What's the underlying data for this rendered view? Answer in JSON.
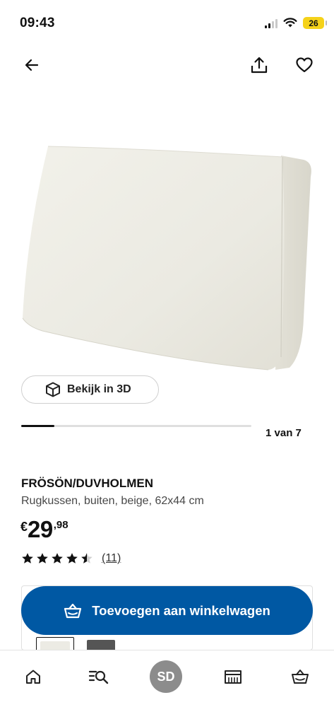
{
  "status_bar": {
    "time": "09:43",
    "battery": "26"
  },
  "product": {
    "name": "FRÖSÖN/DUVHOLMEN",
    "description": "Rugkussen, buiten, beige, 62x44 cm",
    "price": {
      "currency": "€",
      "integer": "29",
      "decimals": ",98"
    },
    "rating": {
      "stars": 4.5,
      "max": 5,
      "count_label": "(11)"
    }
  },
  "view3d": {
    "label": "Bekijk in 3D"
  },
  "gallery": {
    "counter": "1 van 7",
    "current": 1,
    "total": 7
  },
  "cart": {
    "label": "Toevoegen aan winkelwagen"
  },
  "tab_bar": {
    "profile_initials": "SD"
  },
  "colors": {
    "accent": "#0058a3",
    "cushion": "#ecebe4",
    "badge": "#f5d21a"
  }
}
